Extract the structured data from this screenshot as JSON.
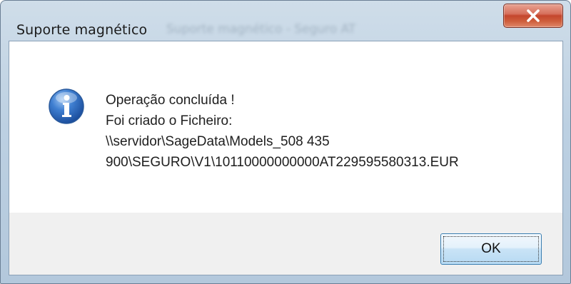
{
  "window": {
    "title": "Suporte magnético",
    "obscured_title_text": "Suporte magnético - Seguro AT",
    "close_label": "X"
  },
  "dialog": {
    "icon": "info-icon",
    "message_lines": [
      "Operação concluída !",
      "Foi criado o Ficheiro:",
      "\\\\servidor\\SageData\\Models_508 435",
      "900\\SEGURO\\V1\\10110000000000AT229595580313.EUR"
    ],
    "ok_label": "OK"
  },
  "colors": {
    "close_button": "#c4462d",
    "ok_button_border": "#3c7fb1",
    "info_icon": "#2a66b8"
  }
}
